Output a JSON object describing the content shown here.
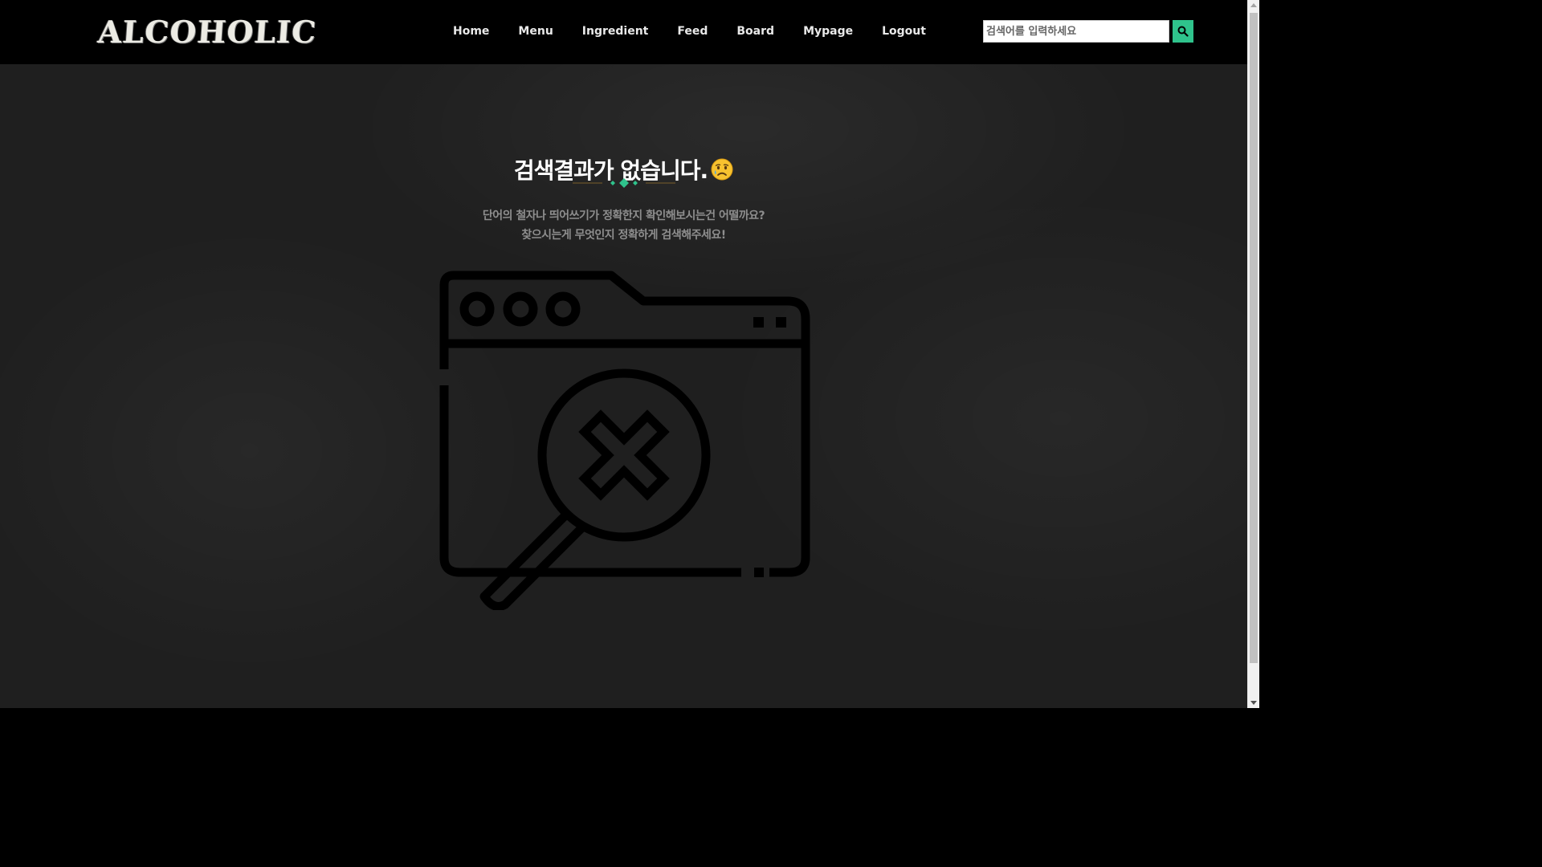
{
  "header": {
    "logo_text": "ALCOHOLIC",
    "nav": [
      "Home",
      "Menu",
      "Ingredient",
      "Feed",
      "Board",
      "Mypage",
      "Logout"
    ],
    "search": {
      "placeholder": "검색어를 입력하세요",
      "button_icon": "search-icon"
    }
  },
  "main": {
    "title": "검색결과가 없습니다.",
    "title_emoji_icon": "sad-face-emoji-icon",
    "message_line1": "단어의 철자나 띄어쓰기가 정확한지 확인해보시는건 어떨까요?",
    "message_line2": "찾으시는게 무엇인지 정확하게 검색해주세요!",
    "illustration_icon": "no-search-results-icon"
  },
  "colors": {
    "accent": "#2fc38c",
    "divider_line": "#7a5f2a",
    "navbar_bg": "#000000",
    "page_bg": "#1f1f1f"
  }
}
